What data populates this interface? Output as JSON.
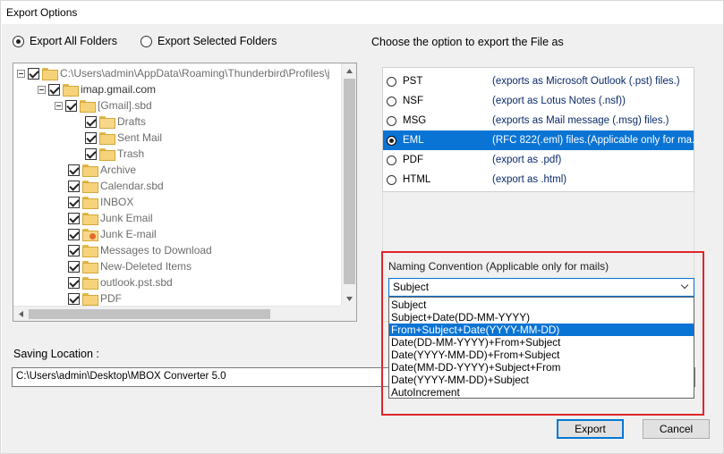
{
  "window": {
    "title": "Export Options"
  },
  "folder_scope": {
    "options": [
      {
        "label": "Export All Folders",
        "checked": true
      },
      {
        "label": "Export Selected Folders",
        "checked": false
      }
    ]
  },
  "tree": {
    "items": [
      {
        "label": "C:\\Users\\admin\\AppData\\Roaming\\Thunderbird\\Profiles\\j",
        "level": 0,
        "expander": true,
        "icon": "folder-icon"
      },
      {
        "label": "imap.gmail.com",
        "level": 1,
        "expander": true,
        "icon": "folder-icon"
      },
      {
        "label": "[Gmail].sbd",
        "level": 2,
        "expander": true,
        "icon": "folder-icon"
      },
      {
        "label": "Drafts",
        "level": 3,
        "expander": false,
        "icon": "drafts-folder-icon"
      },
      {
        "label": "Sent Mail",
        "level": 3,
        "expander": false,
        "icon": "folder-icon"
      },
      {
        "label": "Trash",
        "level": 3,
        "expander": false,
        "icon": "folder-icon"
      },
      {
        "label": "Archive",
        "level": 2,
        "expander": false,
        "icon": "folder-icon"
      },
      {
        "label": "Calendar.sbd",
        "level": 2,
        "expander": false,
        "icon": "folder-icon"
      },
      {
        "label": "INBOX",
        "level": 2,
        "expander": false,
        "icon": "folder-icon"
      },
      {
        "label": "Junk Email",
        "level": 2,
        "expander": false,
        "icon": "folder-icon"
      },
      {
        "label": "Junk E-mail",
        "level": 2,
        "expander": false,
        "icon": "junk-folder-icon"
      },
      {
        "label": "Messages to Download",
        "level": 2,
        "expander": false,
        "icon": "folder-icon"
      },
      {
        "label": "New-Deleted Items",
        "level": 2,
        "expander": false,
        "icon": "folder-icon"
      },
      {
        "label": "outlook.pst.sbd",
        "level": 2,
        "expander": false,
        "icon": "folder-icon"
      },
      {
        "label": "PDF",
        "level": 2,
        "expander": false,
        "icon": "folder-icon"
      }
    ]
  },
  "export_format": {
    "heading": "Choose the option to export the File as",
    "options": [
      {
        "name": "PST",
        "desc": "(exports as Microsoft Outlook (.pst) files.)",
        "checked": false
      },
      {
        "name": "NSF",
        "desc": "(export as Lotus Notes (.nsf))",
        "checked": false
      },
      {
        "name": "MSG",
        "desc": "(exports as Mail message (.msg) files.)",
        "checked": false
      },
      {
        "name": "EML",
        "desc": "(RFC 822(.eml) files.(Applicable only for ma...",
        "checked": true
      },
      {
        "name": "PDF",
        "desc": "(export as .pdf)",
        "checked": false
      },
      {
        "name": "HTML",
        "desc": "(export as .html)",
        "checked": false
      }
    ]
  },
  "naming": {
    "label": "Naming Convention (Applicable only for mails)",
    "selected": "Subject",
    "options": [
      "Subject",
      "Subject+Date(DD-MM-YYYY)",
      "From+Subject+Date(YYYY-MM-DD)",
      "Date(DD-MM-YYYY)+From+Subject",
      "Date(YYYY-MM-DD)+From+Subject",
      "Date(MM-DD-YYYY)+Subject+From",
      "Date(YYYY-MM-DD)+Subject",
      "AutoIncrement"
    ],
    "highlighted_index": 2
  },
  "saving": {
    "label": "Saving Location :",
    "path": "C:\\Users\\admin\\Desktop\\MBOX Converter 5.0"
  },
  "buttons": {
    "export": "Export",
    "cancel": "Cancel"
  },
  "colors": {
    "selection": "#0a74d4",
    "highlight_border": "#e0252b"
  }
}
